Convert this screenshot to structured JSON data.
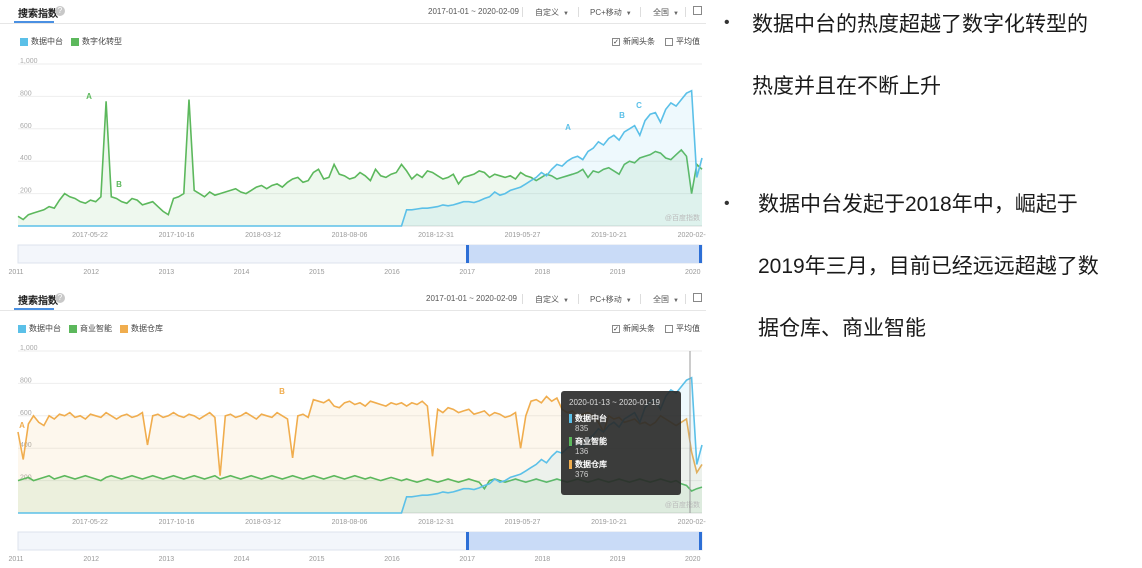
{
  "panels": [
    {
      "title": "搜索指数",
      "date_range": "2017-01-01 ~ 2020-02-09",
      "custom_label": "自定义",
      "device_label": "PC+移动",
      "region_label": "全国",
      "legend": [
        "数据中台",
        "数字化转型"
      ],
      "options": [
        {
          "label": "新闻头条",
          "checked": true
        },
        {
          "label": "平均值",
          "checked": false
        }
      ],
      "watermark": "@百度指数"
    },
    {
      "title": "搜索指数",
      "date_range": "2017-01-01 ~ 2020-02-09",
      "custom_label": "自定义",
      "device_label": "PC+移动",
      "region_label": "全国",
      "legend": [
        "数据中台",
        "商业智能",
        "数据仓库"
      ],
      "options": [
        {
          "label": "新闻头条",
          "checked": true
        },
        {
          "label": "平均值",
          "checked": false
        }
      ],
      "watermark": "@百度指数"
    }
  ],
  "tooltip": {
    "range": "2020-01-13 ~ 2020-01-19",
    "items": [
      {
        "name": "数据中台",
        "value": "835",
        "color": "#5bc0e8"
      },
      {
        "name": "商业智能",
        "value": "136",
        "color": "#5cb85c"
      },
      {
        "name": "数据仓库",
        "value": "376",
        "color": "#f0ad4e"
      }
    ]
  },
  "bullets": [
    {
      "dot": "•",
      "lines": [
        "数据中台的热度超越了数字化转型的",
        "热度并且在不断上升"
      ]
    },
    {
      "dot": "•",
      "lines": [
        "数据中台发起于2018年中，崛起于",
        "2019年三月，目前已经远远超越了数",
        "据仓库、商业智能"
      ]
    }
  ],
  "colors": {
    "blue": "#5bc0e8",
    "green": "#5cb85c",
    "orange": "#f0ad4e",
    "accent": "#4a90e2"
  },
  "chart_data": [
    {
      "type": "line",
      "ylim": [
        0,
        1000
      ],
      "yticks": [
        "1,000",
        "800",
        "600",
        "400",
        "200"
      ],
      "xtick_labels": [
        "2017-05-22",
        "2017-10-16",
        "2018-03-12",
        "2018-08-06",
        "2018-12-31",
        "2019-05-27",
        "2019-10-21",
        "2020-02-03"
      ],
      "overview_years": [
        "2011",
        "2012",
        "2013",
        "2014",
        "2015",
        "2016",
        "2017",
        "2018",
        "2019",
        "2020"
      ],
      "grid": true,
      "legend_position": "top-left",
      "annotations": [
        {
          "label": "A",
          "series": "数字化转型"
        },
        {
          "label": "B",
          "series": "数字化转型"
        },
        {
          "label": "A",
          "series": "数据中台"
        },
        {
          "label": "B",
          "series": "数据中台"
        },
        {
          "label": "C",
          "series": "数据中台"
        }
      ],
      "series": [
        {
          "name": "数据中台",
          "color": "#5bc0e8",
          "values": [
            0,
            0,
            0,
            0,
            0,
            0,
            0,
            0,
            0,
            0,
            0,
            0,
            0,
            0,
            0,
            0,
            0,
            0,
            0,
            0,
            0,
            0,
            0,
            0,
            0,
            0,
            0,
            0,
            0,
            0,
            0,
            0,
            0,
            0,
            0,
            0,
            0,
            0,
            0,
            0,
            0,
            0,
            0,
            0,
            0,
            0,
            0,
            0,
            0,
            0,
            0,
            0,
            0,
            0,
            0,
            0,
            0,
            0,
            0,
            0,
            0,
            0,
            0,
            0,
            0,
            0,
            0,
            0,
            0,
            0,
            0,
            0,
            0,
            0,
            0,
            100,
            100,
            105,
            110,
            110,
            115,
            120,
            130,
            125,
            130,
            140,
            150,
            150,
            145,
            155,
            170,
            180,
            210,
            190,
            200,
            220,
            230,
            240,
            260,
            280,
            300,
            330,
            310,
            350,
            380,
            370,
            400,
            420,
            430,
            410,
            460,
            480,
            520,
            500,
            540,
            560,
            530,
            580,
            600,
            620,
            560,
            650,
            690,
            700,
            640,
            720,
            760,
            740,
            780,
            820,
            835,
            300,
            420
          ]
        },
        {
          "name": "数字化转型",
          "color": "#5cb85c",
          "values": [
            60,
            40,
            70,
            80,
            90,
            100,
            120,
            110,
            160,
            200,
            180,
            170,
            150,
            140,
            160,
            150,
            180,
            770,
            180,
            170,
            150,
            140,
            170,
            160,
            130,
            140,
            150,
            120,
            90,
            70,
            170,
            180,
            200,
            780,
            220,
            200,
            180,
            210,
            190,
            200,
            210,
            220,
            230,
            210,
            200,
            220,
            240,
            250,
            230,
            250,
            260,
            240,
            270,
            290,
            300,
            270,
            280,
            330,
            350,
            290,
            300,
            380,
            320,
            310,
            290,
            300,
            330,
            310,
            280,
            350,
            310,
            300,
            320,
            330,
            380,
            340,
            290,
            320,
            300,
            340,
            330,
            310,
            290,
            300,
            320,
            260,
            300,
            310,
            320,
            340,
            330,
            300,
            320,
            310,
            300,
            310,
            290,
            330,
            310,
            300,
            280,
            300,
            320,
            310,
            290,
            300,
            310,
            320,
            330,
            350,
            300,
            340,
            330,
            350,
            360,
            340,
            320,
            380,
            400,
            390,
            420,
            430,
            440,
            460,
            450,
            420,
            410,
            440,
            470,
            430,
            200,
            380,
            350
          ]
        }
      ]
    },
    {
      "type": "line",
      "ylim": [
        0,
        1000
      ],
      "yticks": [
        "1,000",
        "800",
        "600",
        "400",
        "200"
      ],
      "xtick_labels": [
        "2017-05-22",
        "2017-10-16",
        "2018-03-12",
        "2018-08-06",
        "2018-12-31",
        "2019-05-27",
        "2019-10-21",
        "2020-02-03"
      ],
      "overview_years": [
        "2011",
        "2012",
        "2013",
        "2014",
        "2015",
        "2016",
        "2017",
        "2018",
        "2019",
        "2020"
      ],
      "grid": true,
      "legend_position": "top-left",
      "annotations": [
        {
          "label": "A",
          "series": "数据仓库"
        },
        {
          "label": "B",
          "series": "数据仓库"
        }
      ],
      "series": [
        {
          "name": "数据中台",
          "color": "#5bc0e8",
          "values": [
            0,
            0,
            0,
            0,
            0,
            0,
            0,
            0,
            0,
            0,
            0,
            0,
            0,
            0,
            0,
            0,
            0,
            0,
            0,
            0,
            0,
            0,
            0,
            0,
            0,
            0,
            0,
            0,
            0,
            0,
            0,
            0,
            0,
            0,
            0,
            0,
            0,
            0,
            0,
            0,
            0,
            0,
            0,
            0,
            0,
            0,
            0,
            0,
            0,
            0,
            0,
            0,
            0,
            0,
            0,
            0,
            0,
            0,
            0,
            0,
            0,
            0,
            0,
            0,
            0,
            0,
            0,
            0,
            0,
            0,
            0,
            0,
            0,
            0,
            0,
            100,
            100,
            105,
            110,
            110,
            115,
            120,
            130,
            125,
            130,
            140,
            150,
            150,
            145,
            155,
            170,
            180,
            210,
            190,
            200,
            220,
            230,
            240,
            260,
            280,
            300,
            330,
            310,
            350,
            380,
            370,
            400,
            420,
            430,
            410,
            460,
            480,
            520,
            500,
            540,
            560,
            530,
            580,
            600,
            620,
            560,
            650,
            690,
            700,
            640,
            720,
            760,
            740,
            780,
            820,
            835,
            300,
            420
          ]
        },
        {
          "name": "商业智能",
          "color": "#5cb85c",
          "values": [
            200,
            210,
            220,
            200,
            210,
            220,
            230,
            210,
            220,
            230,
            220,
            210,
            220,
            230,
            220,
            210,
            200,
            220,
            230,
            220,
            210,
            220,
            230,
            220,
            210,
            220,
            230,
            220,
            210,
            220,
            230,
            220,
            210,
            220,
            230,
            220,
            210,
            220,
            230,
            210,
            220,
            230,
            220,
            210,
            220,
            230,
            220,
            210,
            220,
            230,
            220,
            210,
            220,
            230,
            220,
            210,
            220,
            230,
            220,
            210,
            220,
            230,
            220,
            210,
            220,
            230,
            220,
            210,
            220,
            210,
            200,
            210,
            220,
            210,
            200,
            210,
            200,
            190,
            200,
            210,
            200,
            190,
            200,
            210,
            200,
            190,
            200,
            210,
            200,
            190,
            150,
            200,
            210,
            200,
            190,
            200,
            210,
            200,
            190,
            200,
            210,
            200,
            190,
            200,
            210,
            200,
            190,
            200,
            210,
            200,
            190,
            200,
            210,
            200,
            190,
            200,
            210,
            200,
            190,
            200,
            210,
            200,
            190,
            200,
            210,
            200,
            190,
            200,
            180,
            170,
            136,
            150,
            160
          ]
        },
        {
          "name": "数据仓库",
          "color": "#f0ad4e",
          "values": [
            500,
            330,
            550,
            600,
            560,
            540,
            600,
            580,
            610,
            600,
            620,
            590,
            600,
            580,
            610,
            600,
            590,
            620,
            600,
            580,
            600,
            610,
            590,
            600,
            620,
            420,
            600,
            610,
            590,
            600,
            620,
            600,
            590,
            610,
            600,
            580,
            600,
            620,
            590,
            230,
            600,
            610,
            590,
            600,
            620,
            600,
            580,
            610,
            600,
            590,
            620,
            600,
            580,
            340,
            600,
            610,
            590,
            700,
            690,
            680,
            700,
            660,
            650,
            680,
            690,
            670,
            680,
            660,
            690,
            680,
            670,
            660,
            680,
            670,
            680,
            660,
            680,
            670,
            690,
            660,
            350,
            640,
            620,
            650,
            640,
            620,
            630,
            640,
            610,
            620,
            630,
            600,
            620,
            610,
            590,
            600,
            620,
            400,
            600,
            690,
            700,
            680,
            720,
            690,
            710,
            640,
            620,
            630,
            600,
            610,
            620,
            600,
            560,
            500,
            600,
            580,
            590,
            560,
            570,
            580,
            550,
            560,
            540,
            560,
            600,
            580,
            560,
            540,
            560,
            580,
            376,
            250,
            300
          ]
        }
      ]
    }
  ]
}
